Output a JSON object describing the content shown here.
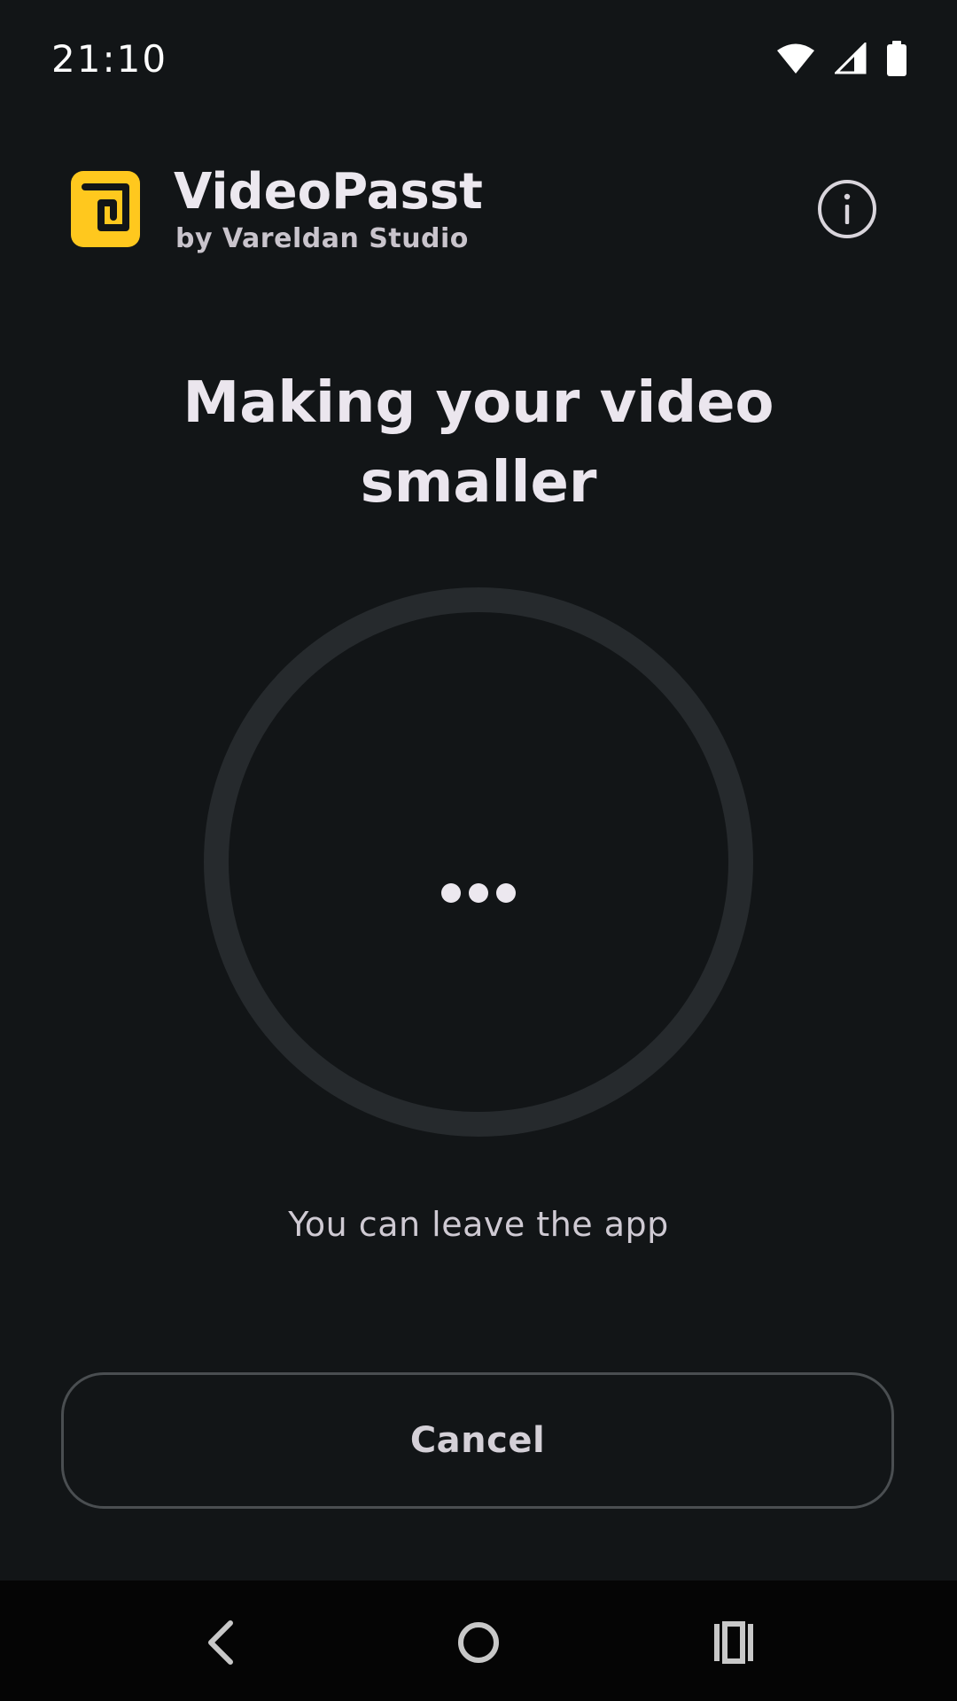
{
  "status_bar": {
    "time": "21:10",
    "icons": [
      "wifi-icon",
      "cellular-signal-icon",
      "battery-icon"
    ]
  },
  "header": {
    "app_name": "VideoPasst",
    "subtitle": "by Vareldan Studio",
    "logo_icon": "videopasst-logo-icon",
    "info_icon": "info-icon"
  },
  "main": {
    "title": "Making your video smaller",
    "progress_indicator": "•••",
    "hint": "You can leave the app",
    "cancel_label": "Cancel"
  },
  "nav_bar": {
    "buttons": [
      "back-icon",
      "home-icon",
      "recents-icon"
    ]
  },
  "colors": {
    "background": "#121517",
    "accent": "#FFC81E",
    "ring_track": "#262A2D",
    "text_primary": "#EBE6EE",
    "nav_background": "#050505"
  }
}
